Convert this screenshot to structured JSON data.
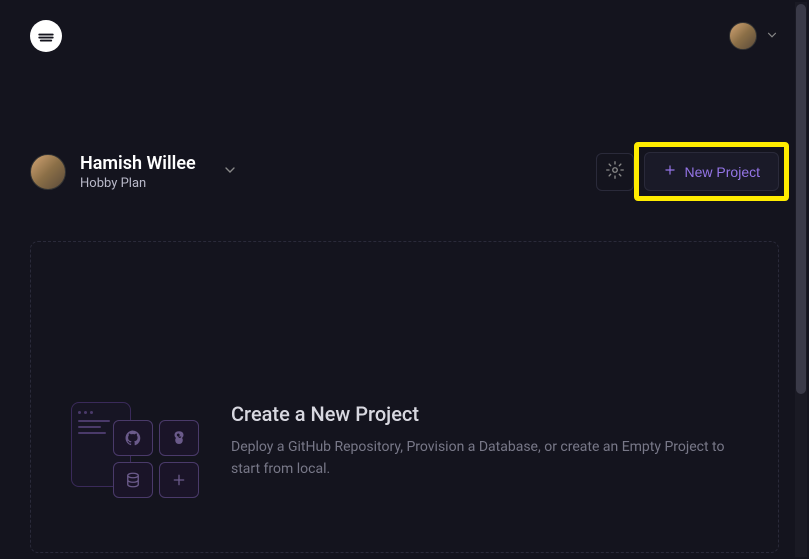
{
  "header": {
    "logo_alt": "Railway"
  },
  "profile": {
    "name": "Hamish Willee",
    "plan": "Hobby Plan"
  },
  "actions": {
    "new_project_label": "New Project"
  },
  "empty_state": {
    "title": "Create a New Project",
    "description": "Deploy a GitHub Repository, Provision a Database, or create an Empty Project to start from local."
  }
}
